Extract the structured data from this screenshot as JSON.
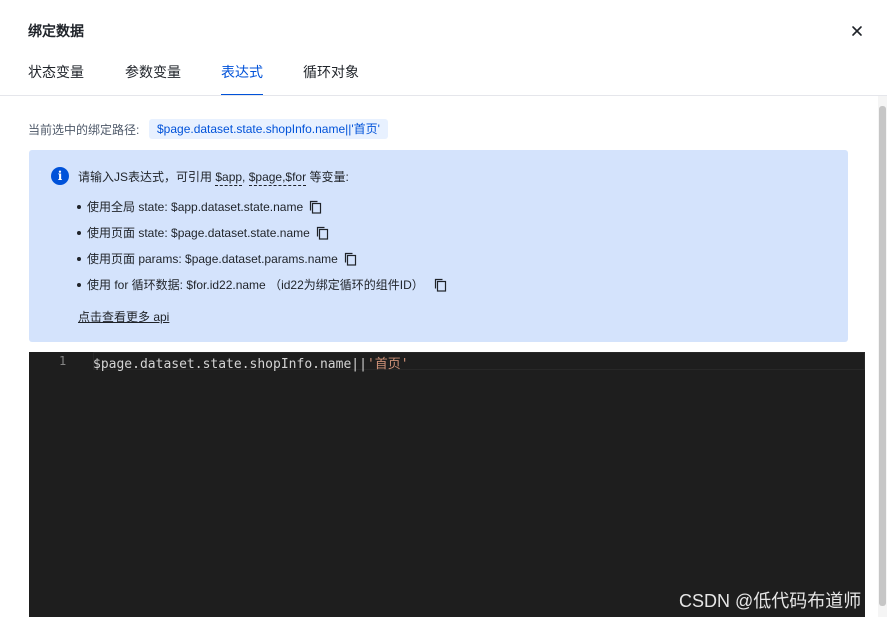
{
  "dialog": {
    "title": "绑定数据",
    "close_icon": "close-icon"
  },
  "tabs": [
    {
      "label": "状态变量",
      "active": false
    },
    {
      "label": "参数变量",
      "active": false
    },
    {
      "label": "表达式",
      "active": true
    },
    {
      "label": "循环对象",
      "active": false
    }
  ],
  "binding_path": {
    "label": "当前选中的绑定路径:",
    "value": "$page.dataset.state.shopInfo.name||'首页'"
  },
  "info": {
    "icon": "info-icon",
    "head_prefix": "请输入JS表达式，可引用 ",
    "var_app": "$app",
    "sep1": ", ",
    "var_page_for": "$page,$for",
    "head_suffix": " 等变量:",
    "items": [
      {
        "text": "使用全局 state: $app.dataset.state.name",
        "icon": "copy-icon"
      },
      {
        "text": "使用页面 state: $page.dataset.state.name",
        "icon": "copy-icon"
      },
      {
        "text": "使用页面 params: $page.dataset.params.name",
        "icon": "copy-icon"
      },
      {
        "text": "使用 for 循环数据: $for.id22.name （id22为绑定循环的组件ID）",
        "icon": "copy-icon"
      }
    ],
    "more_link": "点击查看更多 api"
  },
  "editor": {
    "line_number": "1",
    "code_plain": "$page.dataset.state.shopInfo.name||",
    "code_string": "'首页'"
  },
  "watermark": "CSDN @低代码布道师",
  "colors": {
    "accent": "#0052d9",
    "info_bg": "#d4e3fc",
    "editor_bg": "#1e1e1e",
    "string": "#ce9178"
  }
}
